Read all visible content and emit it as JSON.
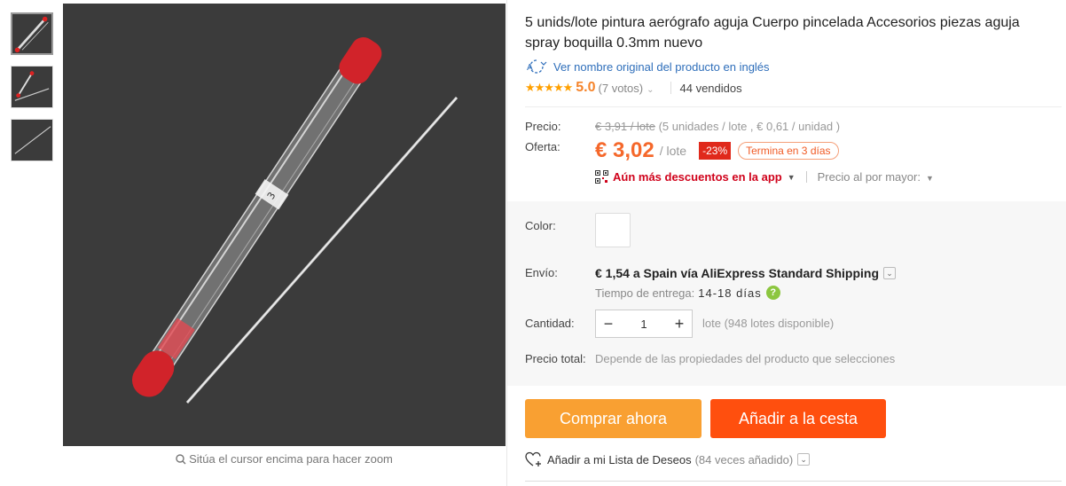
{
  "gallery": {
    "zoom_hint": "Sitúa el cursor encima para hacer zoom"
  },
  "product": {
    "title": "5 unids/lote pintura aerógrafo aguja Cuerpo pincelada Accesorios piezas aguja spray boquilla 0.3mm nuevo",
    "original_name_link": "Ver nombre original del producto en inglés",
    "rating": "5.0",
    "stars": "★★★★★",
    "votes": "(7 votos)",
    "sold": "44 vendidos"
  },
  "pricing": {
    "price_label": "Precio:",
    "old_price": "€ 3,91 / lote",
    "old_price_detail": "(5 unidades / lote , € 0,61 / unidad )",
    "offer_label": "Oferta:",
    "offer_price": "€ 3,02",
    "offer_unit": "/ lote",
    "discount": "-23%",
    "ends": "Termina en 3 días",
    "app_discount": "Aún más descuentos en la app",
    "wholesale": "Precio al por mayor:"
  },
  "options": {
    "color_label": "Color:",
    "shipping_label": "Envío:",
    "shipping_text": "€ 1,54 a Spain vía AliExpress Standard Shipping",
    "delivery_label": "Tiempo de entrega:",
    "delivery_days": "14-18 días",
    "quantity_label": "Cantidad:",
    "quantity_value": "1",
    "quantity_note": "lote (948 lotes disponible)",
    "total_label": "Precio total:",
    "total_note": "Depende de las propiedades del producto que selecciones"
  },
  "actions": {
    "buy_now": "Comprar ahora",
    "add_to_cart": "Añadir a la cesta",
    "wishlist": "Añadir a mi Lista de Deseos",
    "wishlist_count": "(84 veces añadido)"
  },
  "colors": {
    "offer": "#f5682b",
    "discount_bg": "#e0291b",
    "buy_now_bg": "#f9a032",
    "cart_bg": "#ff4f0e",
    "link": "#2e6eba",
    "app_link": "#d0021b"
  }
}
